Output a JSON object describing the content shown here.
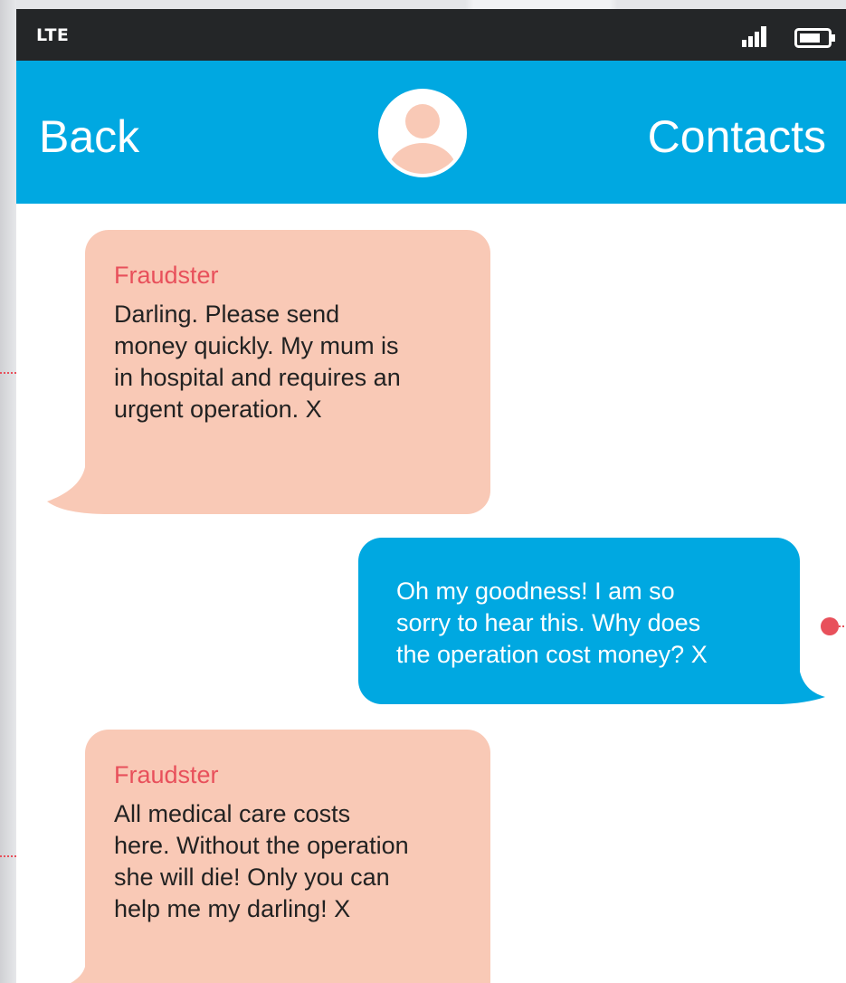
{
  "status_bar": {
    "carrier": "LTE",
    "signal_icon": "signal-bars-icon",
    "battery_icon": "battery-icon"
  },
  "header": {
    "back_label": "Back",
    "contacts_label": "Contacts",
    "avatar_icon": "user-avatar-icon"
  },
  "messages": [
    {
      "direction": "incoming",
      "sender": "Fraudster",
      "lines": [
        "Darling. Please send",
        "money quickly. My mum is",
        "in hospital and requires an",
        "urgent operation. X"
      ]
    },
    {
      "direction": "outgoing",
      "lines": [
        "Oh my goodness! I am so",
        "sorry to hear this. Why does",
        "the operation cost money? X"
      ]
    },
    {
      "direction": "incoming",
      "sender": "Fraudster",
      "lines": [
        "All medical care costs",
        "here. Without the operation",
        "she will die! Only you can",
        "help me my darling! X"
      ]
    }
  ],
  "colors": {
    "header_bg": "#00a8e1",
    "status_bg": "#242628",
    "incoming_bubble": "#f9c9b6",
    "outgoing_bubble": "#00a8e1",
    "sender_name": "#e8505b",
    "connector": "#e8505b"
  }
}
